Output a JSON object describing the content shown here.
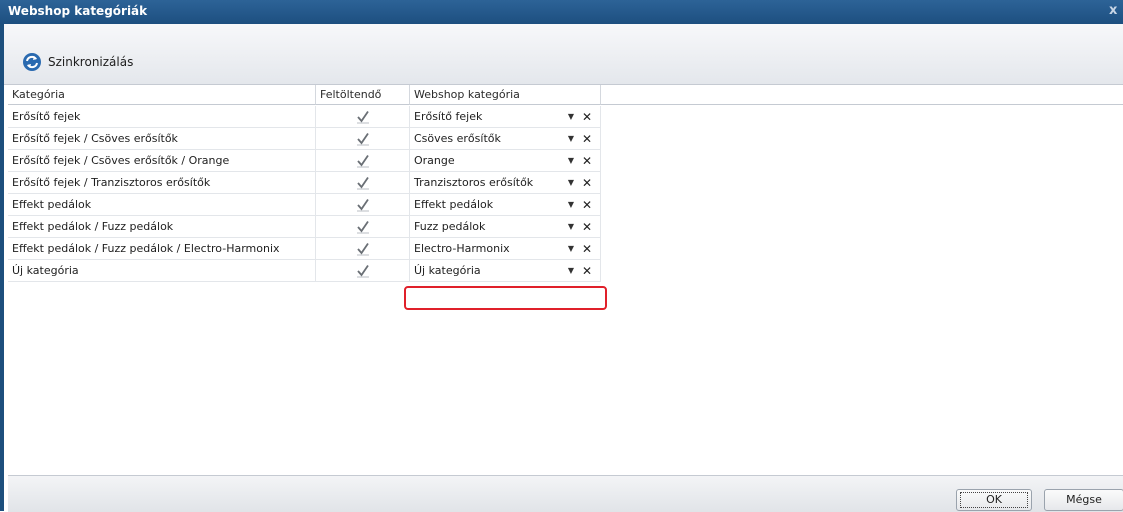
{
  "window": {
    "title": "Webshop kategóriák",
    "close_glyph": "x"
  },
  "toolbar": {
    "sync_label": "Szinkronizálás",
    "sync_icon": "sync-icon"
  },
  "grid": {
    "columns": [
      "Kategória",
      "Feltöltendő",
      "Webshop kategória"
    ],
    "rows": [
      {
        "category": "Erősítő fejek",
        "upload": true,
        "webshop": "Erősítő fejek"
      },
      {
        "category": "Erősítő fejek / Csöves erősítők",
        "upload": true,
        "webshop": "Csöves erősítők"
      },
      {
        "category": "Erősítő fejek / Csöves erősítők / Orange",
        "upload": true,
        "webshop": "Orange"
      },
      {
        "category": "Erősítő fejek / Tranzisztoros erősítők",
        "upload": true,
        "webshop": "Tranzisztoros erősítők"
      },
      {
        "category": "Effekt pedálok",
        "upload": true,
        "webshop": "Effekt pedálok"
      },
      {
        "category": "Effekt pedálok / Fuzz pedálok",
        "upload": true,
        "webshop": "Fuzz pedálok"
      },
      {
        "category": "Effekt pedálok / Fuzz pedálok / Electro-Harmonix",
        "upload": true,
        "webshop": "Electro-Harmonix"
      },
      {
        "category": "Új kategória",
        "upload": true,
        "webshop": "Új kategória"
      }
    ]
  },
  "buttons": {
    "ok": "OK",
    "cancel": "Mégse"
  },
  "colors": {
    "title_bar": "#1d4f80",
    "highlight": "#e0202a"
  }
}
